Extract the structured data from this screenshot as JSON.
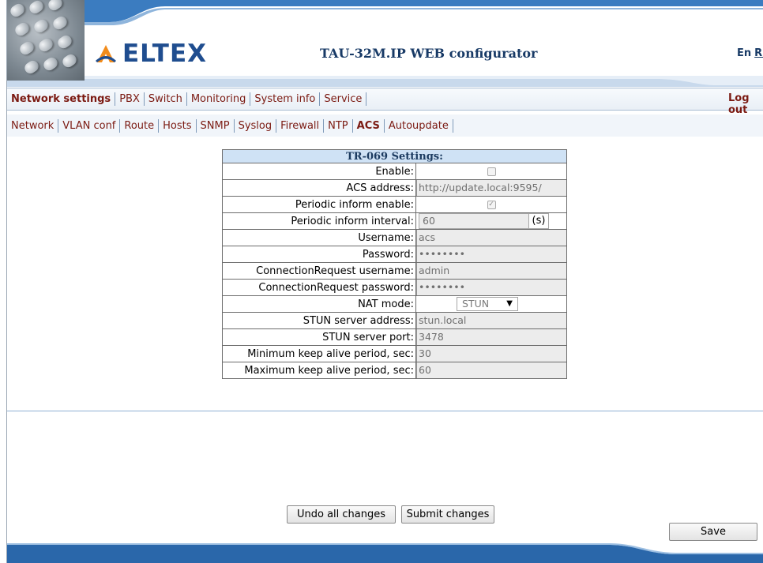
{
  "header": {
    "brand": "ELTEX",
    "title": "TAU-32M.IP WEB configurator",
    "lang_en": "En",
    "lang_ru": "Ru"
  },
  "menu": {
    "main": [
      "Network settings",
      "PBX",
      "Switch",
      "Monitoring",
      "System info",
      "Service"
    ],
    "active_main": "Network settings",
    "logout": "Log out",
    "sub": [
      "Network",
      "VLAN conf",
      "Route",
      "Hosts",
      "SNMP",
      "Syslog",
      "Firewall",
      "NTP",
      "ACS",
      "Autoupdate"
    ],
    "active_sub": "ACS"
  },
  "tr069": {
    "title": "TR-069 Settings:",
    "enable_label": "Enable:",
    "enable_checked": false,
    "acs_address_label": "ACS address:",
    "acs_address": "http://update.local:9595/",
    "periodic_inform_enable_label": "Periodic inform enable:",
    "periodic_inform_enable_checked": true,
    "periodic_inform_interval_label": "Periodic inform interval:",
    "periodic_inform_interval": "60",
    "interval_unit": "(s)",
    "username_label": "Username:",
    "username": "acs",
    "password_label": "Password:",
    "password": "••••••••",
    "cr_username_label": "ConnectionRequest username:",
    "cr_username": "admin",
    "cr_password_label": "ConnectionRequest password:",
    "cr_password": "••••••••",
    "nat_mode_label": "NAT mode:",
    "nat_mode": "STUN",
    "stun_address_label": "STUN server address:",
    "stun_address": "stun.local",
    "stun_port_label": "STUN server port:",
    "stun_port": "3478",
    "min_keepalive_label": "Minimum keep alive period, sec:",
    "min_keepalive": "30",
    "max_keepalive_label": "Maximum keep alive period, sec:",
    "max_keepalive": "60"
  },
  "buttons": {
    "undo": "Undo all changes",
    "submit": "Submit changes",
    "save": "Save"
  },
  "colors": {
    "menu_text": "#7b1a12",
    "brand_blue": "#1f4d8f",
    "table_header_bg": "#cfe2f5",
    "footer_blue": "#2663a6"
  }
}
